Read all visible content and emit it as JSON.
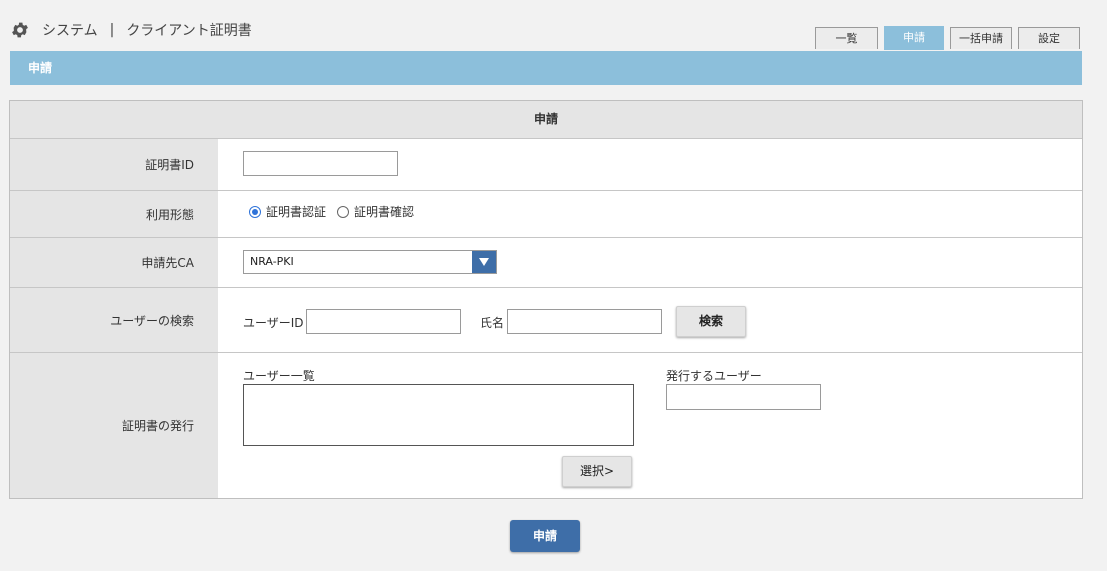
{
  "header": {
    "icon": "gear-icon",
    "section": "システム",
    "separator": "|",
    "page": "クライアント証明書"
  },
  "tabs": [
    {
      "label": "一覧",
      "active": false
    },
    {
      "label": "申請",
      "active": true
    },
    {
      "label": "一括申請",
      "active": false
    },
    {
      "label": "設定",
      "active": false
    }
  ],
  "banner": {
    "label": "申請"
  },
  "form": {
    "heading": "申請",
    "cert_id": {
      "label": "証明書ID",
      "value": ""
    },
    "usage": {
      "label": "利用形態",
      "options": [
        {
          "label": "証明書認証",
          "selected": true
        },
        {
          "label": "証明書確認",
          "selected": false
        }
      ]
    },
    "ca": {
      "label": "申請先CA",
      "selected": "NRA-PKI"
    },
    "user_search": {
      "label": "ユーザーの検索",
      "userid_label": "ユーザーID",
      "userid_value": "",
      "name_label": "氏名",
      "name_value": "",
      "search_button": "検索"
    },
    "issue": {
      "label": "証明書の発行",
      "user_list_label": "ユーザー一覧",
      "issue_users_label": "発行するユーザー",
      "select_button": "選択>"
    }
  },
  "submit_button": "申請",
  "colors": {
    "banner": "#8cbfdb",
    "primary_button": "#3e6ea8",
    "label_bg": "#e5e5e5"
  }
}
